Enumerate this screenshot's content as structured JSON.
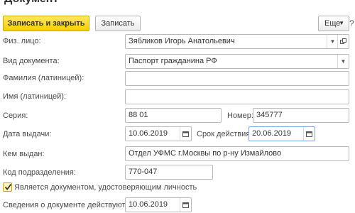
{
  "window": {
    "title": "Документ"
  },
  "toolbar": {
    "save_close_label": "Записать и закрыть",
    "save_label": "Записать",
    "more_label": "Еще"
  },
  "form": {
    "person_label": "Физ. лицо:",
    "person_value": "Зябликов Игорь Анатольевич",
    "doc_type_label": "Вид документа:",
    "doc_type_value": "Паспорт гражданина РФ",
    "surname_lat_label": "Фамилия (латиницей):",
    "surname_lat_value": "",
    "name_lat_label": "Имя (латиницей):",
    "name_lat_value": "",
    "series_label": "Серия:",
    "series_value": "88 01",
    "number_label": "Номер:",
    "number_value": "345777",
    "issue_date_label": "Дата выдачи:",
    "issue_date_value": "10.06.2019",
    "expiry_label": "Срок действия:",
    "expiry_value": "20.06.2019",
    "issued_by_label": "Кем выдан:",
    "issued_by_value": "Отдел УФМС г.Москвы по р-ну Измайлово",
    "dept_code_label": "Код подразделения:",
    "dept_code_value": "770-047",
    "identity_checkbox_label": "Является документом, удостоверяющим личность",
    "identity_checked": true,
    "valid_from_label": "Сведения о документе действуют с:",
    "valid_from_value": "10.06.2019"
  },
  "icons": {
    "dropdown": "chevron-down-icon",
    "open": "open-link-icon",
    "calendar": "calendar-icon",
    "help": "help-icon",
    "check": "check-icon"
  },
  "colors": {
    "primary_button": "#f5d000",
    "checkbox_bg": "#fff5b8",
    "focus_border": "#7fa4d6"
  }
}
